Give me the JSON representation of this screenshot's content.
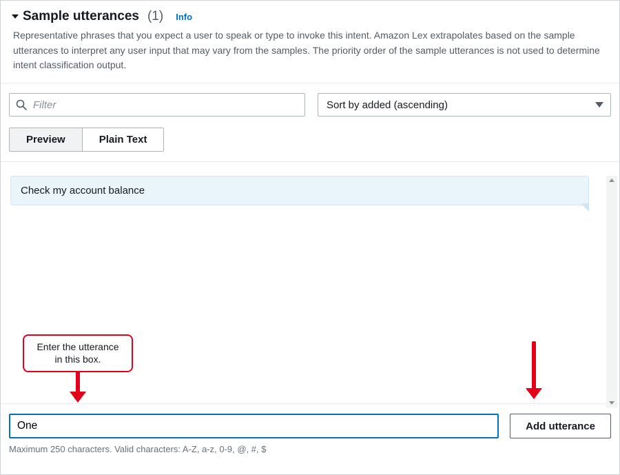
{
  "header": {
    "title": "Sample utterances",
    "count": "(1)",
    "info_label": "Info",
    "description": "Representative phrases that you expect a user to speak or type to invoke this intent. Amazon Lex extrapolates based on the sample utterances to interpret any user input that may vary from the samples. The priority order of the sample utterances is not used to determine intent classification output."
  },
  "controls": {
    "filter_placeholder": "Filter",
    "sort_value": "Sort by added (ascending)"
  },
  "tabs": {
    "preview": "Preview",
    "plain": "Plain Text"
  },
  "utterances": {
    "first": "Check my account balance"
  },
  "callouts": {
    "input_hint": "Enter the utterance in this box."
  },
  "add": {
    "input_value": "One",
    "button_label": "Add utterance",
    "hint_text": "Maximum 250 characters. Valid characters: A-Z, a-z, 0-9, @, #, $"
  }
}
